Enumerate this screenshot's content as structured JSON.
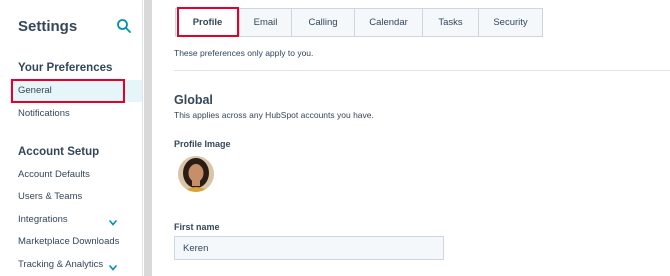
{
  "sidebar": {
    "title": "Settings",
    "sections": [
      {
        "title": "Your Preferences",
        "items": [
          {
            "label": "General",
            "active": true
          },
          {
            "label": "Notifications"
          }
        ]
      },
      {
        "title": "Account Setup",
        "items": [
          {
            "label": "Account Defaults"
          },
          {
            "label": "Users & Teams"
          },
          {
            "label": "Integrations",
            "expandable": true
          },
          {
            "label": "Marketplace Downloads"
          },
          {
            "label": "Tracking & Analytics",
            "expandable": true
          }
        ]
      }
    ]
  },
  "tabs": [
    {
      "label": "Profile",
      "active": true
    },
    {
      "label": "Email"
    },
    {
      "label": "Calling"
    },
    {
      "label": "Calendar"
    },
    {
      "label": "Tasks"
    },
    {
      "label": "Security"
    }
  ],
  "main": {
    "intro": "These preferences only apply to you.",
    "global_title": "Global",
    "global_subtitle": "This applies across any HubSpot accounts you have.",
    "profile_image_label": "Profile Image",
    "first_name_label": "First name",
    "first_name_value": "Keren"
  },
  "colors": {
    "accent": "#0091ae",
    "highlight": "#e4002b",
    "active_bg": "#e5f5f8"
  }
}
